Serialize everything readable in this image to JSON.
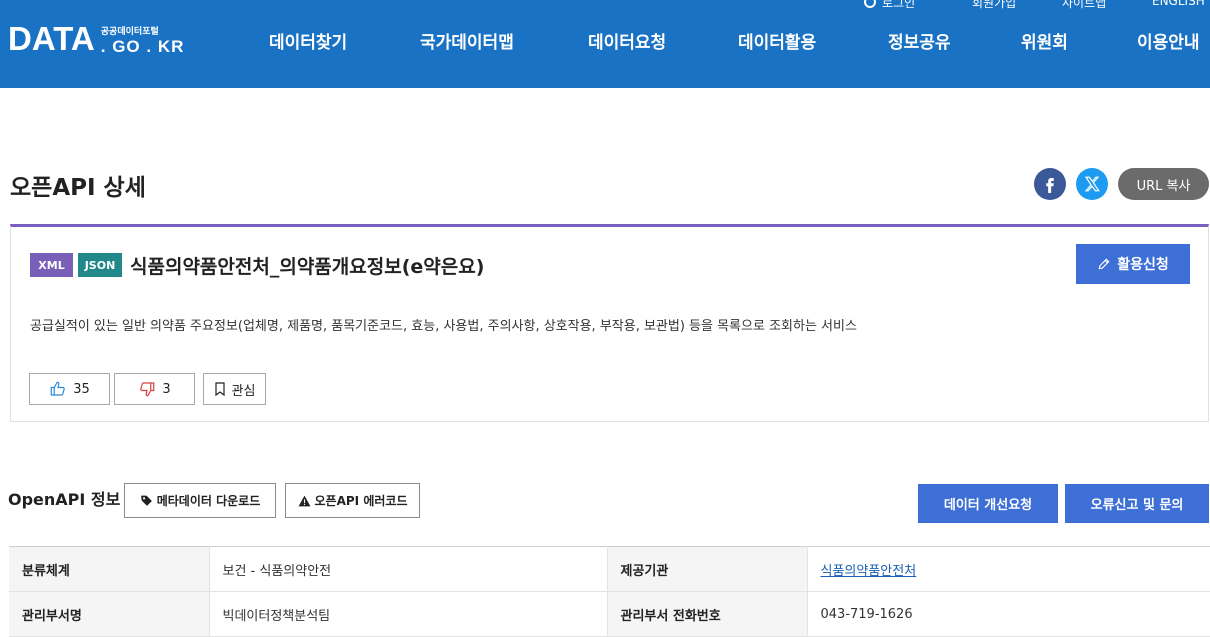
{
  "header": {
    "logo_main": "DATA",
    "logo_sub": "공공데이터포털",
    "logo_domain": ". GO . KR",
    "util_links": [
      "로그인",
      "회원가입",
      "사이트맵",
      "ENGLISH"
    ],
    "nav": [
      "데이터찾기",
      "국가데이터맵",
      "데이터요청",
      "데이터활용",
      "정보공유",
      "위원회",
      "이용안내"
    ],
    "bg_color": "#1a72c4"
  },
  "page": {
    "title": "오픈API 상세",
    "url_copy_label": "URL 복사"
  },
  "detail": {
    "tags": [
      "XML",
      "JSON"
    ],
    "title": "식품의약품안전처_의약품개요정보(e약은요)",
    "apply_label": "활용신청",
    "description": "공급실적이 있는 일반 의약품 주요정보(업체명, 제품명, 품목기준코드, 효능, 사용법, 주의사항, 상호작용, 부작용, 보관법) 등을 목록으로 조회하는 서비스",
    "likes": "35",
    "dislikes": "3",
    "bookmark_label": "관심"
  },
  "openapi": {
    "section_title": "OpenAPI 정보",
    "meta_download_label": "메타데이터 다운로드",
    "error_code_label": "오픈API 에러코드",
    "improve_label": "데이터 개선요청",
    "report_label": "오류신고 및 문의"
  },
  "info_table": {
    "rows": [
      [
        "분류체계",
        "보건 - 식품의약안전",
        "제공기관",
        "식품의약품안전처"
      ],
      [
        "관리부서명",
        "빅데이터정책분석팀",
        "관리부서 전화번호",
        "043-719-1626"
      ]
    ]
  },
  "colors": {
    "accent_blue": "#3d6fd6",
    "xml_tag": "#7a5fb8",
    "json_tag": "#23888a",
    "box_top_border": "#7a5fc0"
  }
}
